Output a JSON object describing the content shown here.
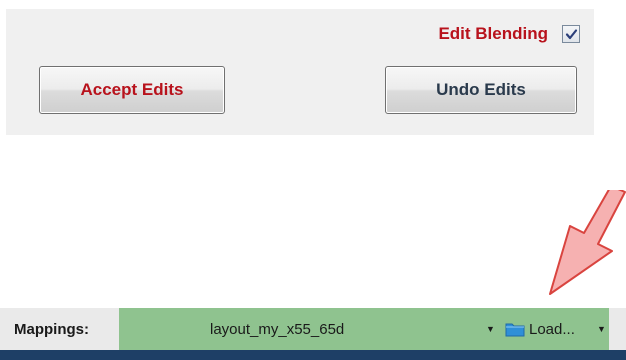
{
  "panel": {
    "blend_label": "Edit Blending",
    "blend_checked": true,
    "accept_label": "Accept Edits",
    "undo_label": "Undo Edits"
  },
  "toolbar": {
    "mappings_label": "Mappings:",
    "mapping_value": "layout_my_x55_65d",
    "load_label": "Load...",
    "load_icon": "folder-icon",
    "combo_color": "#8fc38f"
  },
  "colors": {
    "accent_red": "#b8121c",
    "arrow_fill": "#f6b1b1",
    "arrow_stroke": "#d9443f",
    "strip": "#1e3f66"
  }
}
